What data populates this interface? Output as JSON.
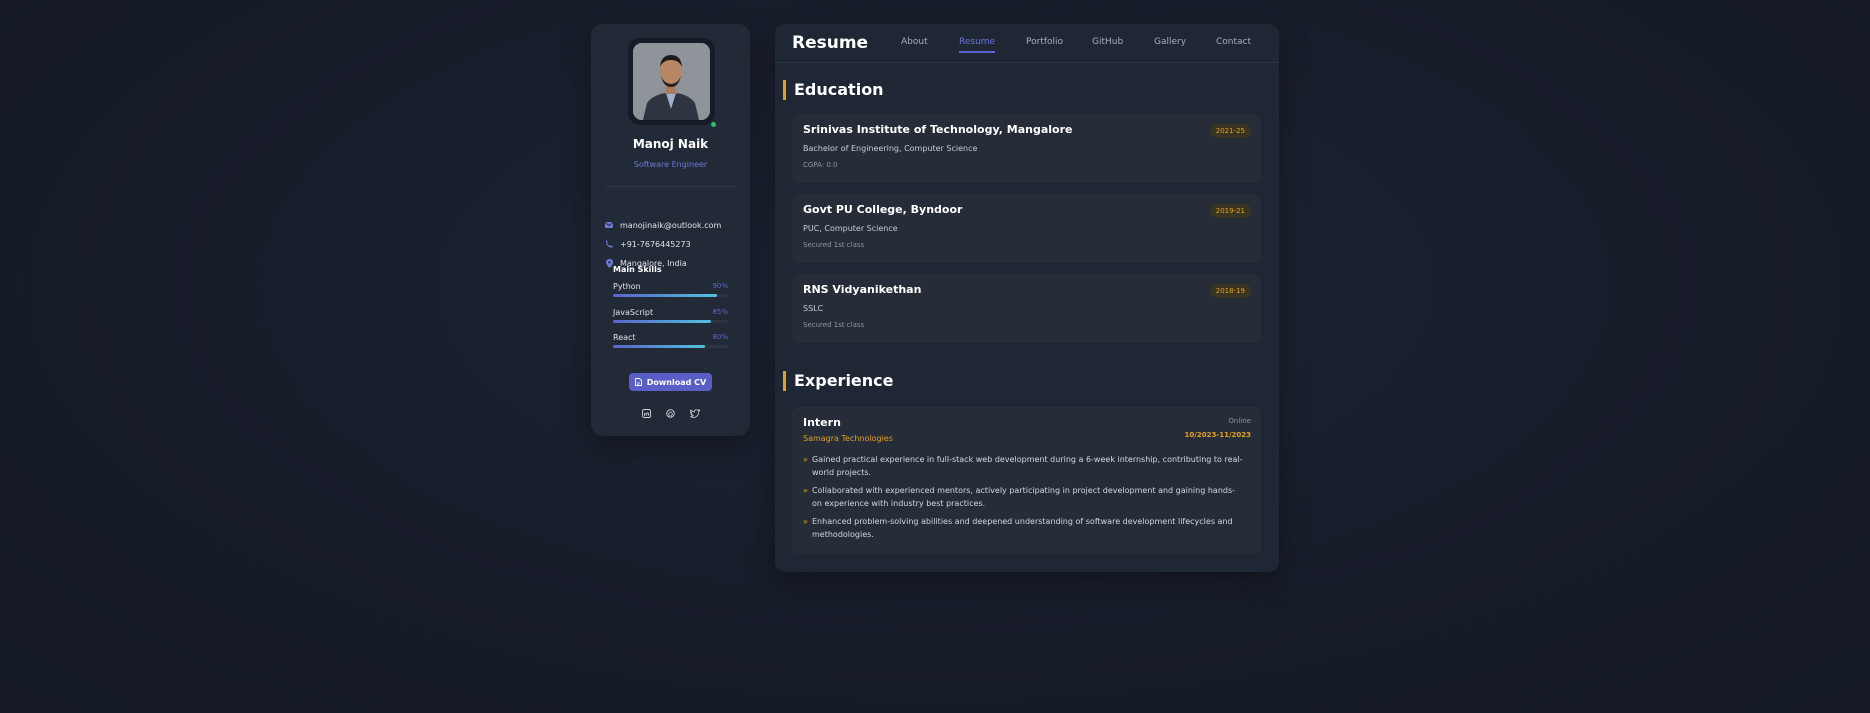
{
  "profile": {
    "name": "Manoj Naik",
    "role": "Software Engineer",
    "contacts": [
      {
        "icon": "mail-icon",
        "text": "manojinaik@outlook.com"
      },
      {
        "icon": "phone-icon",
        "text": "+91-7676445273"
      },
      {
        "icon": "location-icon",
        "text": "Mangalore, India"
      }
    ],
    "skills_title": "Main Skills",
    "skills": [
      {
        "name": "Python",
        "percent_label": "90%",
        "level": 0.9
      },
      {
        "name": "JavaScript",
        "percent_label": "85%",
        "level": 0.85
      },
      {
        "name": "React",
        "percent_label": "80%",
        "level": 0.8
      }
    ],
    "download_label": "Download CV",
    "socials": [
      "linkedin-icon",
      "github-icon",
      "twitter-icon"
    ]
  },
  "header": {
    "title": "Resume",
    "nav": [
      "About",
      "Resume",
      "Portfolio",
      "GitHub",
      "Gallery",
      "Contact"
    ],
    "active": "Resume"
  },
  "education": {
    "heading": "Education",
    "items": [
      {
        "school": "Srinivas Institute of Technology, Mangalore",
        "years": "2021-25",
        "degree": "Bachelor of Engineering, Computer Science",
        "note": "CGPA: 0.0"
      },
      {
        "school": "Govt PU College, Byndoor",
        "years": "2019-21",
        "degree": "PUC, Computer Science",
        "note": "Secured 1st class"
      },
      {
        "school": "RNS Vidyanikethan",
        "years": "2018-19",
        "degree": "SSLC",
        "note": "Secured 1st class"
      }
    ]
  },
  "experience": {
    "heading": "Experience",
    "items": [
      {
        "title": "Intern",
        "mode": "Online",
        "company": "Samagra Technologies",
        "dates": "10/2023-11/2023",
        "bullets": [
          "Gained practical experience in full-stack web development during a 6-week internship, contributing to real-world projects.",
          "Collaborated with experienced mentors, actively participating in project development and gaining hands-on experience with industry best practices.",
          "Enhanced problem-solving abilities and deepened understanding of software development lifecycles and methodologies."
        ]
      }
    ]
  },
  "colors": {
    "accent": "#5a62d6",
    "highlight": "#e3a21a",
    "status": "#22c55e"
  }
}
